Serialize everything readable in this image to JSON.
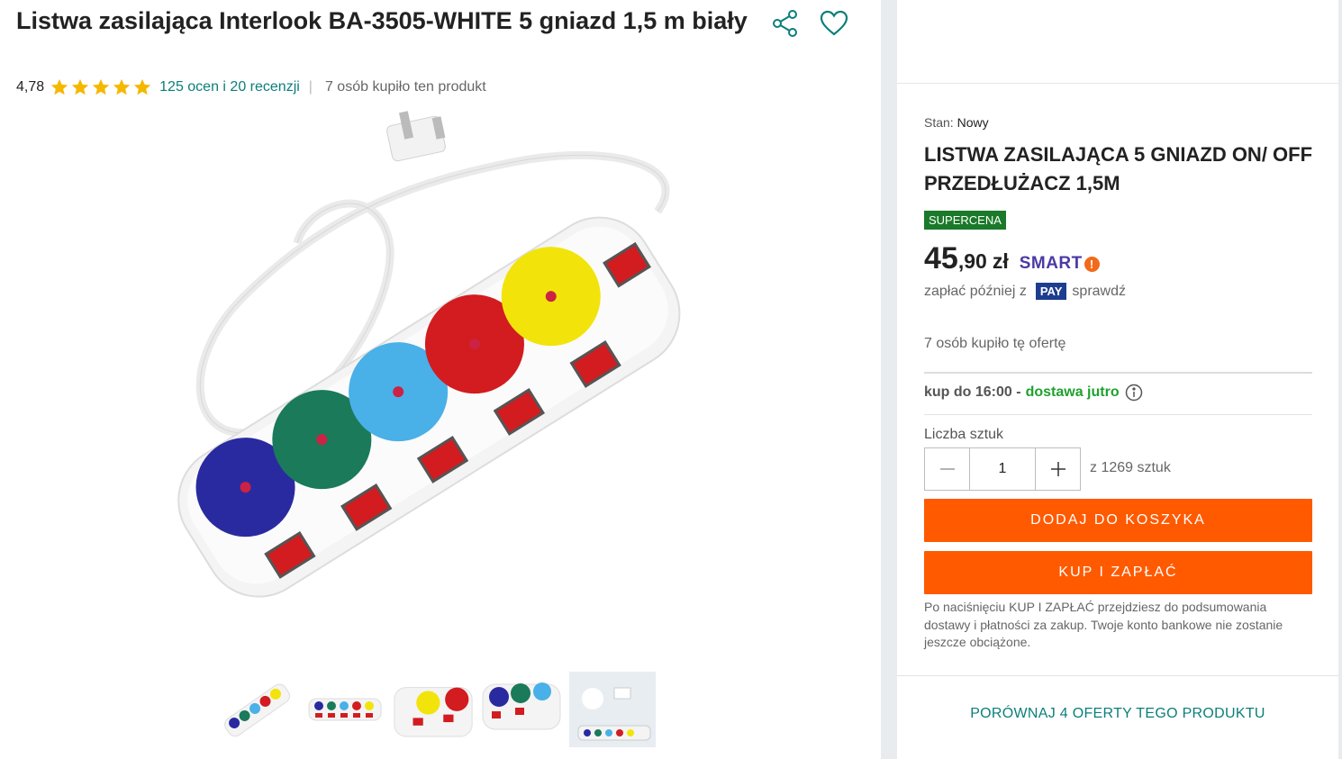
{
  "product": {
    "title": "Listwa zasilająca Interlook BA-3505-WHITE 5 gniazd 1,5 m biały",
    "rating": "4,78",
    "reviews_link": "125 ocen i 20 recenzji",
    "separator": "|",
    "buyers": "7 osób kupiło ten produkt",
    "stars_count": 5
  },
  "icons": {
    "share": "share-icon",
    "favorite": "heart-icon",
    "star": "star-icon",
    "info": "info-icon",
    "minus": "minus-icon",
    "plus": "plus-icon"
  },
  "offer": {
    "condition_label": "Stan:",
    "condition_value": "Nowy",
    "title": "LISTWA ZASILAJĄCA 5 GNIAZD ON/ OFF PRZEDŁUŻACZ 1,5M",
    "badge": "SUPERCENA",
    "price_int": "45",
    "price_dec": ",90",
    "currency": "zł",
    "smart_label": "SMART",
    "smart_mark": "!",
    "paylater_text": "zapłać później z",
    "pay_badge": "PAY",
    "paylater_check": "sprawdź",
    "bought": "7 osób kupiło tę ofertę",
    "delivery_prefix": "kup do 16:00 -",
    "delivery_green": "dostawa jutro",
    "qty_label": "Liczba sztuk",
    "qty_value": "1",
    "stock": "z 1269 sztuk",
    "add_to_cart": "DODAJ DO KOSZYKA",
    "buy_now": "KUP I ZAPŁAĆ",
    "note": "Po naciśnięciu KUP I ZAPŁAĆ przejdziesz do podsumowania dostawy i płatności za zakup. Twoje konto bankowe nie zostanie jeszcze obciążone.",
    "compare": "PORÓWNAJ 4 OFERTY TEGO PRODUKTU"
  },
  "colors": {
    "accent_orange": "#ff5a00",
    "link_teal": "#0a7f79",
    "delivery_green": "#1fa12f",
    "badge_green": "#1a7a2a",
    "star_yellow": "#f5b800",
    "pay_blue": "#1d3d8f"
  }
}
